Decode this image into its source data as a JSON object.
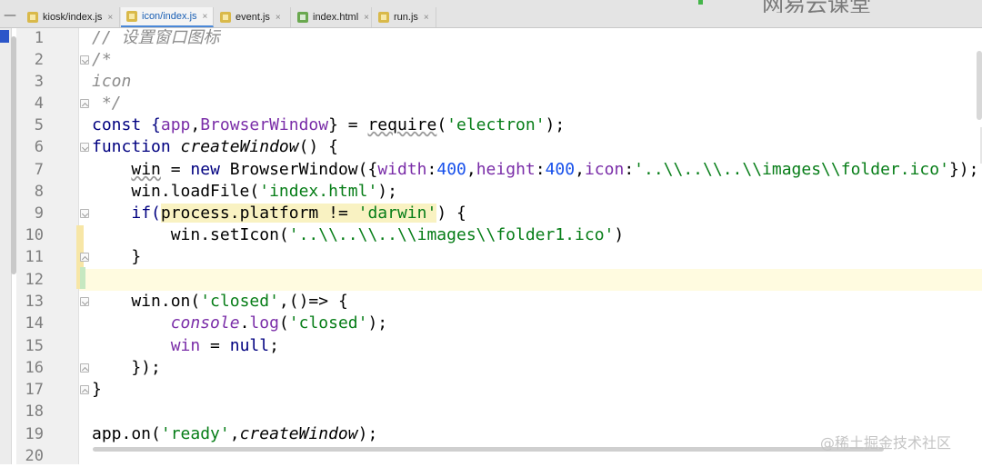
{
  "tabs": [
    {
      "name": "kiosk/index.js",
      "type": "js",
      "active": false
    },
    {
      "name": "icon/index.js",
      "type": "js",
      "active": true
    },
    {
      "name": "event.js",
      "type": "js",
      "active": false
    },
    {
      "name": "index.html",
      "type": "html",
      "active": false
    },
    {
      "name": "run.js",
      "type": "js",
      "active": false
    }
  ],
  "close_glyph": "×",
  "collapse_glyph": "—",
  "watermark_top": "网易云课堂",
  "watermark_bottom": "@稀土掘金技术社区",
  "line_numbers": [
    "1",
    "2",
    "3",
    "4",
    "5",
    "6",
    "7",
    "8",
    "9",
    "10",
    "11",
    "12",
    "13",
    "14",
    "15",
    "16",
    "17",
    "18",
    "19",
    "20"
  ],
  "code": {
    "l1": "// 设置窗口图标",
    "l2": "/*",
    "l3": "icon",
    "l4": " */",
    "l5": {
      "a": "const {",
      "b": "app",
      "c": ",",
      "d": "BrowserWindow",
      "e": "} = ",
      "f": "require",
      "g": "(",
      "h": "'electron'",
      "i": ");"
    },
    "l6": {
      "a": "function ",
      "b": "createWindow",
      "c": "() {"
    },
    "l7": {
      "a": "    ",
      "b": "win",
      "c": " = ",
      "d": "new ",
      "e": "BrowserWindow",
      "f": "({",
      "g": "width",
      "h": ":",
      "i": "400",
      "j": ",",
      "k": "height",
      "l": ":",
      "m": "400",
      "n": ",",
      "o": "icon",
      "p": ":",
      "q": "'..\\\\..\\\\..\\\\images\\\\folder.ico'",
      "r": "});"
    },
    "l8": {
      "a": "    win.loadFile(",
      "b": "'index.html'",
      "c": ");"
    },
    "l9": {
      "a": "    ",
      "b": "if(",
      "c": "process.platform != ",
      "d": "'darwin'",
      "e": ") {"
    },
    "l10": {
      "a": "        win.setIcon(",
      "b": "'..\\\\..\\\\..\\\\images\\\\folder1.ico'",
      "c": ")"
    },
    "l11": "    }",
    "l12": "",
    "l13": {
      "a": "    win.on(",
      "b": "'closed'",
      "c": ",()=> {"
    },
    "l14": {
      "a": "        ",
      "b": "console",
      "c": ".",
      "d": "log",
      "e": "(",
      "f": "'closed'",
      "g": ");"
    },
    "l15": {
      "a": "        ",
      "b": "win",
      "c": " = ",
      "d": "null",
      "e": ";"
    },
    "l16": "    });",
    "l17": "}",
    "l18": "",
    "l19": {
      "a": "app.on(",
      "b": "'ready'",
      "c": ",",
      "d": "createWindow",
      "e": ");"
    }
  },
  "colors": {
    "keyword": "#000080",
    "string": "#067d17",
    "number": "#1750eb",
    "property": "#7a2da8",
    "comment": "#8c8c8c",
    "accent": "#4a88d8"
  }
}
